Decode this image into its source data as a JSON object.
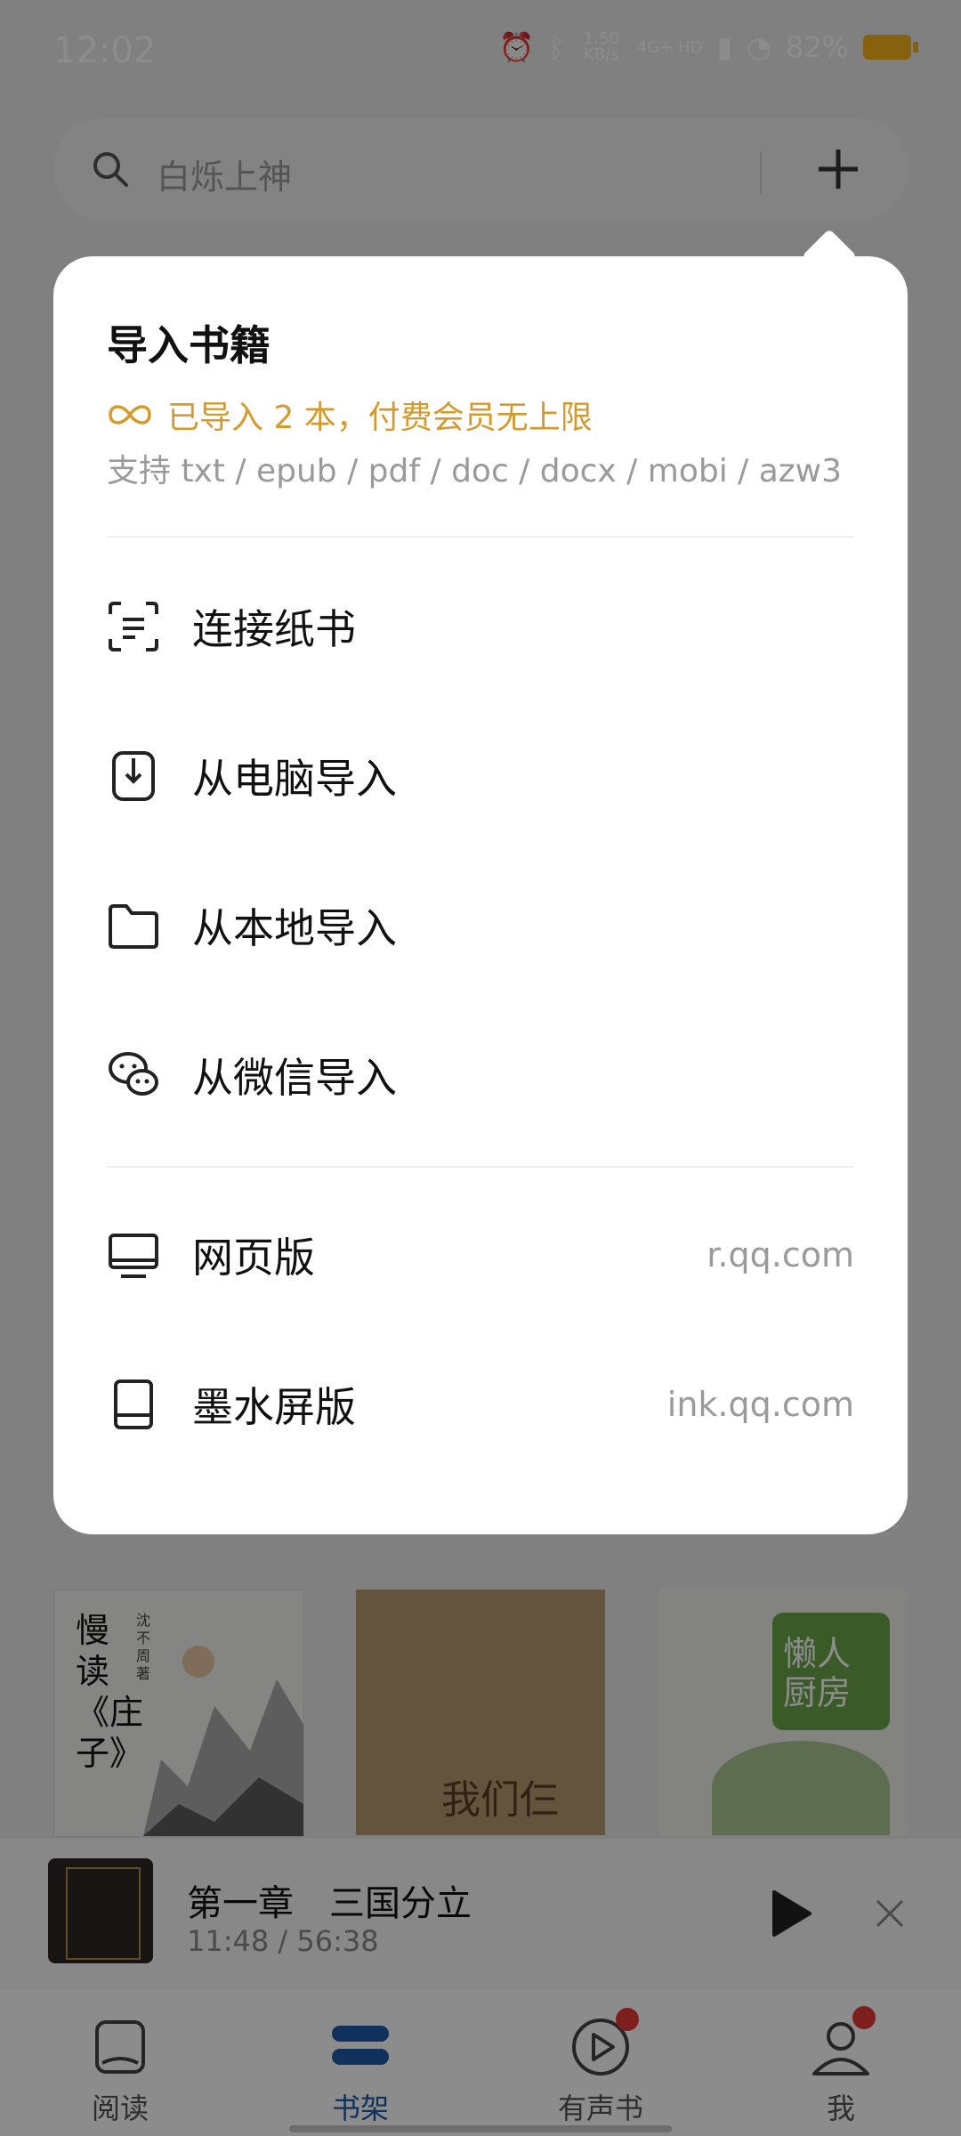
{
  "status_bar": {
    "time": "12:02",
    "net_speed": "1.50 KB/s",
    "network": "4G+ HD",
    "battery": "82%"
  },
  "search": {
    "placeholder": "白烁上神"
  },
  "import_panel": {
    "title": "导入书籍",
    "promo": "已导入 2 本，付费会员无上限",
    "formats": "支持 txt / epub / pdf / doc / docx / mobi / azw3",
    "items": [
      {
        "label": "连接纸书",
        "icon": "scan-frame-icon"
      },
      {
        "label": "从电脑导入",
        "icon": "phone-transfer-icon"
      },
      {
        "label": "从本地导入",
        "icon": "folder-icon"
      },
      {
        "label": "从微信导入",
        "icon": "wechat-icon"
      }
    ],
    "links": [
      {
        "label": "网页版",
        "url": "r.qq.com",
        "icon": "monitor-icon"
      },
      {
        "label": "墨水屏版",
        "url": "ink.qq.com",
        "icon": "ereader-icon"
      }
    ]
  },
  "books": [
    {
      "title": "慢读《庄子》",
      "author": "沈不周 著"
    },
    {
      "title": "我们仨"
    },
    {
      "title": "懒人厨房"
    }
  ],
  "player": {
    "chapter": "第一章　三国分立",
    "progress": "11:48 / 56:38"
  },
  "tabs": [
    {
      "label": "阅读",
      "active": false,
      "badge": false
    },
    {
      "label": "书架",
      "active": true,
      "badge": false
    },
    {
      "label": "有声书",
      "active": false,
      "badge": true
    },
    {
      "label": "我",
      "active": false,
      "badge": true
    }
  ],
  "colors": {
    "accent_gold": "#d59a2e",
    "tab_active": "#1e5aa8",
    "badge_red": "#e53935"
  }
}
